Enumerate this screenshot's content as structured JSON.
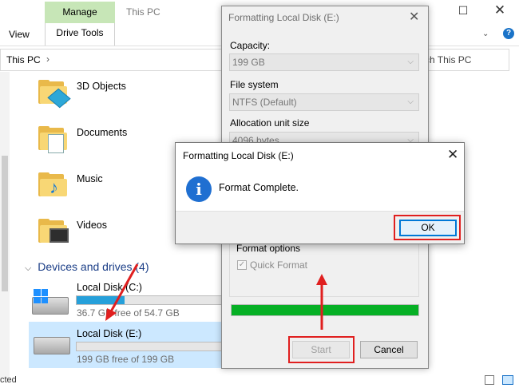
{
  "explorer": {
    "manage_tab": "Manage",
    "drive_tools_tab": "Drive Tools",
    "view_tab": "View",
    "window_title": "This PC",
    "address": "This PC",
    "search_placeholder": "ch This PC",
    "folders": [
      {
        "label": "3D Objects"
      },
      {
        "label": "Documents"
      },
      {
        "label": "Music"
      },
      {
        "label": "Videos"
      }
    ],
    "devices_header": "Devices and drives (4)",
    "drives": [
      {
        "label": "Local Disk (C:)",
        "free": "36.7 GB free of 54.7 GB",
        "used_fraction": 0.33
      },
      {
        "label": "Local Disk (E:)",
        "free": "199 GB free of 199 GB",
        "used_fraction": 0.0
      }
    ],
    "status_text": "cted"
  },
  "format_dialog": {
    "title": "Formatting Local Disk (E:)",
    "capacity_label": "Capacity:",
    "capacity_value": "199 GB",
    "filesystem_label": "File system",
    "filesystem_value": "NTFS (Default)",
    "alloc_label": "Allocation unit size",
    "alloc_value": "4096 bytes",
    "format_options_label": "Format options",
    "quick_format_label": "Quick Format",
    "quick_format_checked": true,
    "progress_fraction": 1.0,
    "start_label": "Start",
    "cancel_label": "Cancel"
  },
  "message_box": {
    "title": "Formatting Local Disk (E:)",
    "message": "Format Complete.",
    "ok_label": "OK",
    "icon": "info-icon"
  },
  "colors": {
    "accent": "#0078d7",
    "progress_green": "#06b025",
    "annotation_red": "#e01f1f",
    "manage_tab_green": "#c7e6b7"
  }
}
